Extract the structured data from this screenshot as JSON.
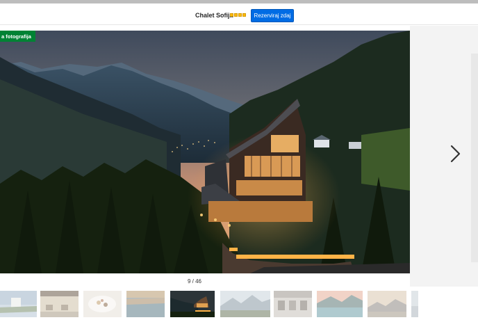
{
  "header": {
    "hotel_name": "Chalet Sofija",
    "star_rating": 4,
    "reserve_label": "Rezerviraj zdaj"
  },
  "gallery": {
    "badge_label": "a fotografija",
    "counter_text": "9 / 46",
    "next_icon": "chevron-right-icon",
    "thumbnails": [
      {
        "scene": "lake-village"
      },
      {
        "scene": "terrace-tables"
      },
      {
        "scene": "plated-dessert"
      },
      {
        "scene": "pool-deck"
      },
      {
        "scene": "chalet-night",
        "active": true
      },
      {
        "scene": "mountain-view"
      },
      {
        "scene": "dining-room"
      },
      {
        "scene": "lake-sunset"
      },
      {
        "scene": "mountain-panorama"
      },
      {
        "scene": "snowy-edge"
      }
    ]
  },
  "colors": {
    "accent": "#006ce4",
    "badge": "#008234",
    "star": "#febb02"
  }
}
